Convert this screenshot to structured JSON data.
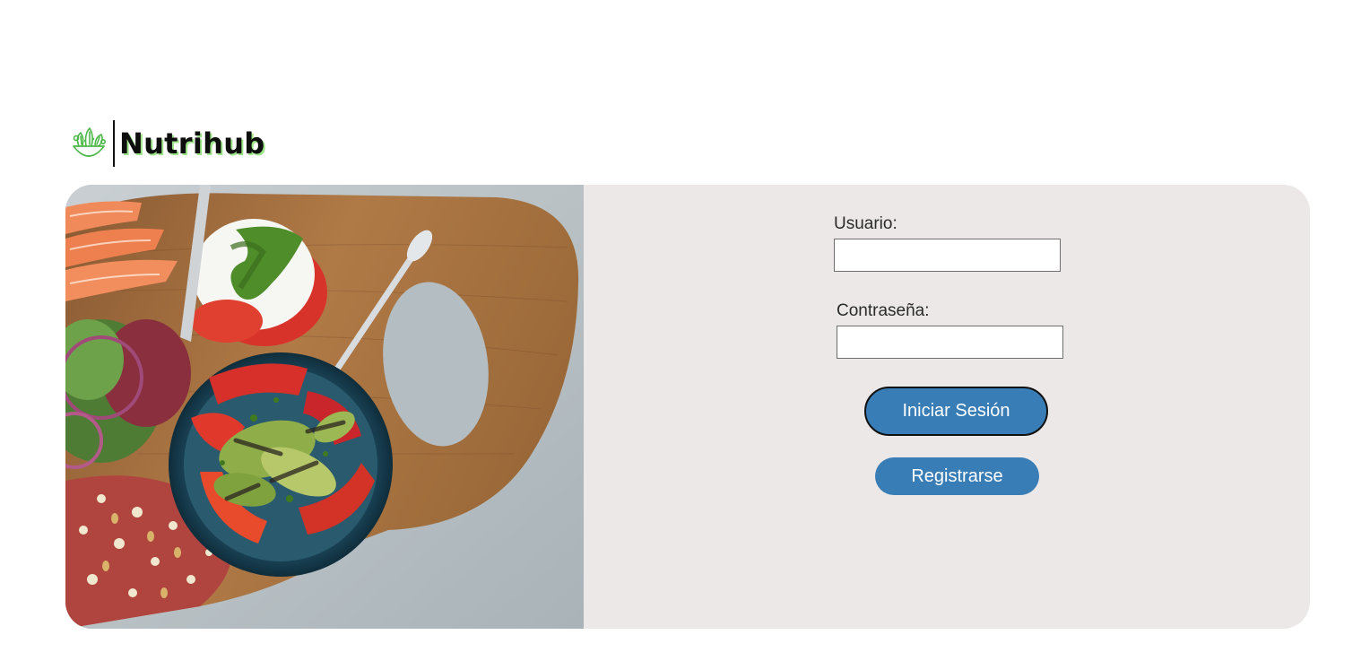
{
  "brand": {
    "name": "Nutrihub",
    "logo_icon": "salad-bowl-icon",
    "accent_color": "#5bbd4a"
  },
  "hero_image": {
    "icon": "food-board-photo"
  },
  "login_form": {
    "username_label": "Usuario:",
    "username_value": "",
    "password_label": "Contraseña:",
    "password_value": "",
    "login_button_label": "Iniciar Sesión",
    "register_button_label": "Registrarse"
  },
  "colors": {
    "button": "#397db6",
    "panel_background": "#ece8e7"
  }
}
